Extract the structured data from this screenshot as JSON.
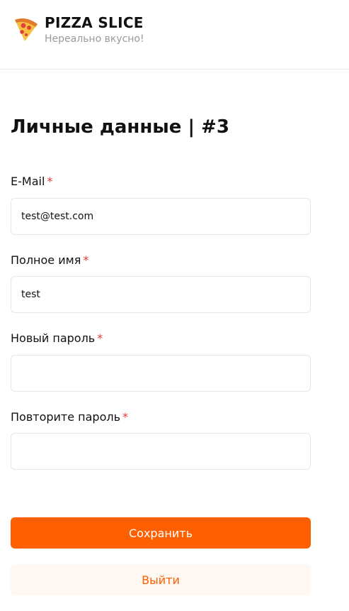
{
  "header": {
    "brand_name": "PIZZA SLICE",
    "tagline": "Нереально вкусно!",
    "logo_icon": "pizza-slice-icon"
  },
  "page": {
    "title": "Личные данные | #3"
  },
  "form": {
    "required_mark": "*",
    "email": {
      "label": "E-Mail",
      "value": "test@test.com"
    },
    "full_name": {
      "label": "Полное имя",
      "value": "test"
    },
    "new_password": {
      "label": "Новый пароль",
      "value": ""
    },
    "repeat_password": {
      "label": "Повторите пароль",
      "value": ""
    },
    "save_label": "Сохранить",
    "logout_label": "Выйти"
  },
  "colors": {
    "accent": "#fe5f00",
    "accent_light": "#fff7f1",
    "required": "#e53935",
    "muted_text": "#9a9a9a"
  }
}
